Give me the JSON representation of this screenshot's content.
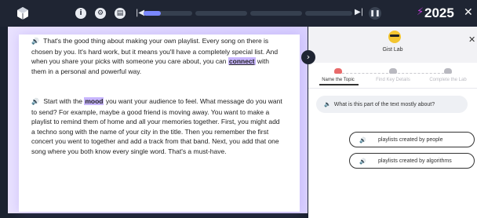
{
  "topbar": {
    "logo_icon": "cube-logo-icon",
    "info_label": "i",
    "settings_label": "⚙",
    "notes_label": "▤",
    "skip_back_label": "|◀",
    "skip_fwd_label": "▶|",
    "pause_label": "❚❚",
    "progress_fraction": 0.09,
    "score": "2025",
    "score_icon": "lightning-bolt-icon",
    "close_label": "✕"
  },
  "reading": {
    "p1_before": " That's the good thing about making your own playlist. Every song on there is chosen by you. It's hard work, but it means you'll have a completely special list. And when you share your picks with someone you care about, you can ",
    "p1_highlight": "connect",
    "p1_after": " with them in a personal and powerful way.",
    "p2_before": " Start with the ",
    "p2_highlight": "mood",
    "p2_after": " you want your audience to feel. What message do you want to send? For example, maybe a good friend is moving away. You want to make a playlist to remind them of home and all your memories together. First, you might add a techno song with the name of your city in the title. Then you remember the first concert you went to together and add a track from that band. Next, you add that one song where you both know every single word. That's a must-have.",
    "speaker_glyph": "🔊"
  },
  "panel": {
    "title": "Gist Lab",
    "close_label": "✕",
    "steps": [
      {
        "label": "Name the Topic",
        "active": true,
        "color": "#e86a6a"
      },
      {
        "label": "Find Key Details",
        "active": false,
        "color": "#b9b9c0"
      },
      {
        "label": "Complete the Lab",
        "active": false,
        "color": "#b9b9c0"
      }
    ],
    "question": "What is this part of the text mostly about?",
    "answers": [
      "playlists created by people",
      "playlists created by algorithms"
    ]
  },
  "colors": {
    "highlight": "#c8b6ff",
    "accent": "#7a88ff",
    "bolt": "#c03dd8"
  }
}
